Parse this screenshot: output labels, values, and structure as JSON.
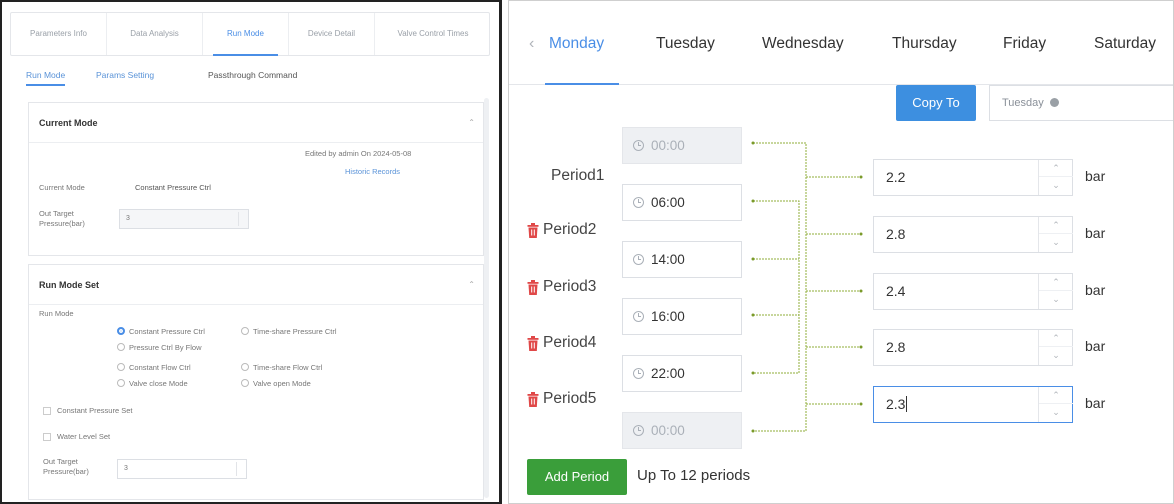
{
  "left": {
    "top_tabs": [
      "Parameters Info",
      "Data Analysis",
      "Run Mode",
      "Device Detail",
      "Valve Control Times"
    ],
    "sub_tabs": [
      "Run Mode",
      "Params Setting",
      "Passthrough Command"
    ],
    "current_mode": {
      "title": "Current Mode",
      "edited_by": "Edited by admin On 2024-05-08",
      "history_link": "Historic Records",
      "mode_label": "Current Mode",
      "mode_value": "Constant Pressure Ctrl",
      "target_label": "Out Target Pressure(bar)",
      "target_value": "3"
    },
    "run_mode_set": {
      "title": "Run Mode Set",
      "run_mode_label": "Run Mode",
      "options": [
        {
          "label": "Constant Pressure Ctrl",
          "selected": true
        },
        {
          "label": "Time-share Pressure Ctrl",
          "selected": false
        },
        {
          "label": "Pressure Ctrl By Flow",
          "selected": false
        },
        {
          "label": "Constant Flow Ctrl",
          "selected": false
        },
        {
          "label": "Time-share Flow Ctrl",
          "selected": false
        },
        {
          "label": "Valve close Mode",
          "selected": false
        },
        {
          "label": "Valve open Mode",
          "selected": false
        }
      ],
      "constant_pressure_set": "Constant Pressure Set",
      "water_level_set": "Water Level Set",
      "target_label": "Out Target Pressure(bar)",
      "target_value": "3"
    }
  },
  "right": {
    "days": [
      "Monday",
      "Tuesday",
      "Wednesday",
      "Thursday",
      "Friday",
      "Saturday"
    ],
    "active_day": "Monday",
    "copy_button": "Copy To",
    "copy_target": "Tuesday",
    "periods": [
      {
        "label": "Period1",
        "value": "2.2",
        "deletable": false
      },
      {
        "label": "Period2",
        "value": "2.8",
        "deletable": true
      },
      {
        "label": "Period3",
        "value": "2.4",
        "deletable": true
      },
      {
        "label": "Period4",
        "value": "2.8",
        "deletable": true
      },
      {
        "label": "Period5",
        "value": "2.3",
        "deletable": true
      }
    ],
    "times": [
      "00:00",
      "06:00",
      "14:00",
      "16:00",
      "22:00",
      "00:00"
    ],
    "unit": "bar",
    "add_button": "Add Period",
    "hint": "Up To 12 periods",
    "colors": {
      "accent": "#4a8ee6",
      "add": "#3a9e3a",
      "delete": "#e04848",
      "connector": "#7a9a2a"
    }
  }
}
